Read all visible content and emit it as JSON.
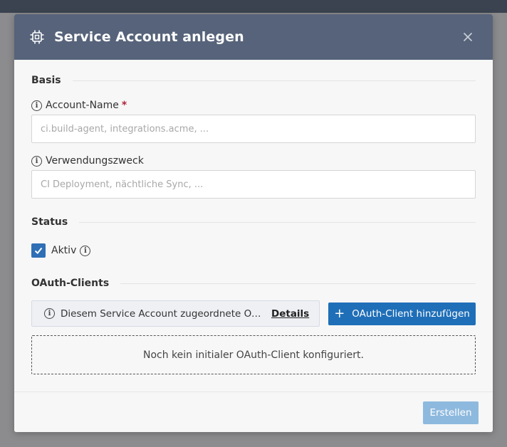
{
  "dialog": {
    "title": "Service Account anlegen",
    "header_icon": "chip-icon",
    "close_icon": "close-icon"
  },
  "sections": {
    "basis": "Basis",
    "status": "Status",
    "oauth": "OAuth-Clients"
  },
  "fields": {
    "account_name": {
      "label": "Account-Name",
      "required_marker": "*",
      "placeholder": "ci.build-agent, integrations.acme, ...",
      "value": ""
    },
    "purpose": {
      "label": "Verwendungszweck",
      "placeholder": "CI Deployment, nächtliche Sync, ...",
      "value": ""
    }
  },
  "status": {
    "active_label": "Aktiv",
    "active_checked": true
  },
  "oauth": {
    "notice_text": "Diesem Service Account zugeordnete OAuth-Clients",
    "details_link": "Details",
    "add_button": "OAuth-Client hinzufügen",
    "empty_text": "Noch kein initialer OAuth-Client konfiguriert."
  },
  "footer": {
    "create_button": "Erstellen"
  },
  "colors": {
    "header_bg": "#56637a",
    "primary": "#1f6fb8",
    "primary_disabled": "#8eb9de",
    "required": "#b0233a"
  }
}
